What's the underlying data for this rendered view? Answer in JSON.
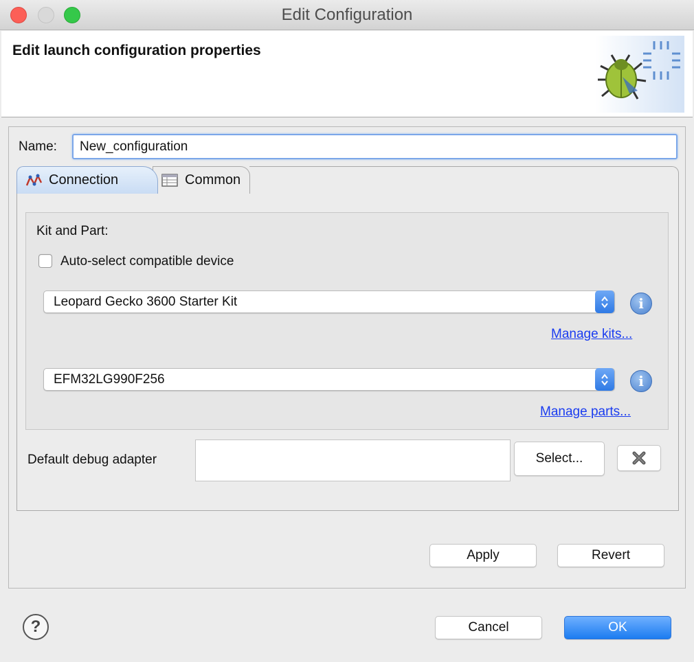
{
  "window": {
    "title": "Edit Configuration"
  },
  "header": {
    "title": "Edit launch configuration properties",
    "icon": "debug-bug-icon"
  },
  "name_field": {
    "label": "Name:",
    "value": "New_configuration"
  },
  "tabs": [
    {
      "label": "Connection",
      "icon": "connection-icon",
      "selected": true
    },
    {
      "label": "Common",
      "icon": "table-icon",
      "selected": false
    }
  ],
  "kit_and_part": {
    "label": "Kit and Part:",
    "auto_select": {
      "label": "Auto-select compatible device",
      "checked": false
    },
    "kit": {
      "value": "Leopard Gecko 3600 Starter Kit",
      "manage_link": "Manage kits..."
    },
    "part": {
      "value": "EFM32LG990F256",
      "manage_link": "Manage parts..."
    }
  },
  "debug_adapter": {
    "label": "Default debug adapter",
    "value": "",
    "select_button": "Select..."
  },
  "panel_buttons": {
    "apply": "Apply",
    "revert": "Revert"
  },
  "dialog_buttons": {
    "cancel": "Cancel",
    "ok": "OK"
  },
  "colors": {
    "accent": "#1c7cf0",
    "link": "#1a3cf0",
    "selected_tab": "#c9dcf4"
  }
}
